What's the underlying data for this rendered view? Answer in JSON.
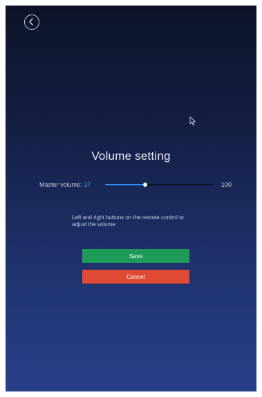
{
  "header": {
    "back_icon": "chevron-left-circle-icon"
  },
  "dialog": {
    "title": "Volume setting",
    "master_volume_label": "Master volume:",
    "master_volume_value": "37",
    "volume_fraction": 0.37,
    "volume_max_label": "100",
    "hint": "Left and right buttons on the remote control to adjust the volume",
    "save_label": "Save",
    "cancel_label": "Cancel"
  },
  "colors": {
    "accent": "#2f8bff",
    "save": "#1f9b59",
    "cancel": "#de4a34",
    "background_top": "#0d1329",
    "background_bottom": "#2a3f8a"
  }
}
